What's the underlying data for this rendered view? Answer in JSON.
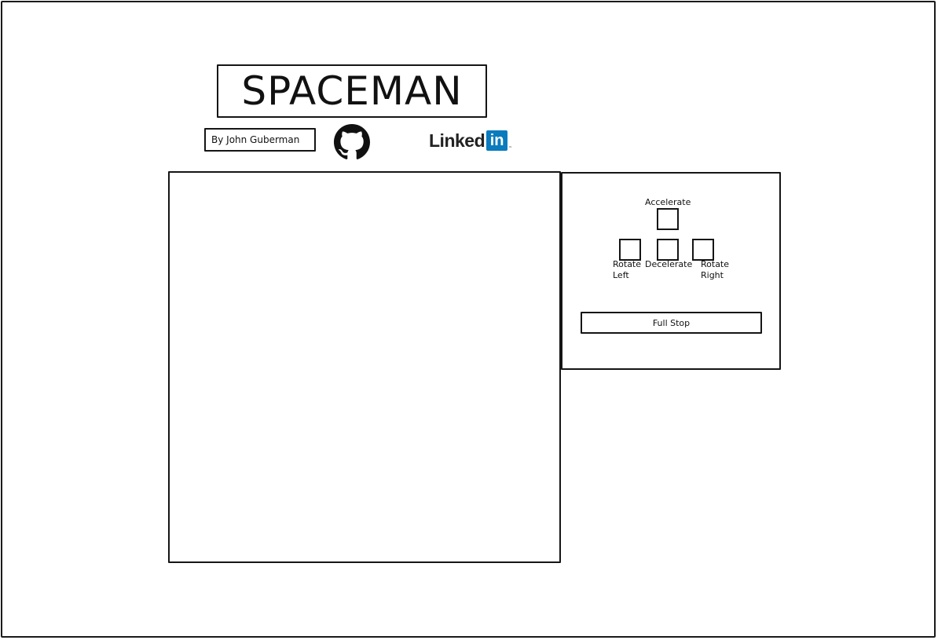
{
  "header": {
    "title": "SPACEMAN",
    "byline": "By John Guberman"
  },
  "social": {
    "github_icon": "github-icon",
    "linkedin_word": "Linked",
    "linkedin_badge": "in",
    "linkedin_tm": "™",
    "linkedin_color": "#0a7bbd"
  },
  "controls": {
    "accelerate_label": "Accelerate",
    "rotate_left_label_1": "Rotate",
    "rotate_left_label_2": "Left",
    "decelerate_label": "Decelerate",
    "rotate_right_label_1": "Rotate",
    "rotate_right_label_2": "Right",
    "full_stop_label": "Full Stop"
  }
}
